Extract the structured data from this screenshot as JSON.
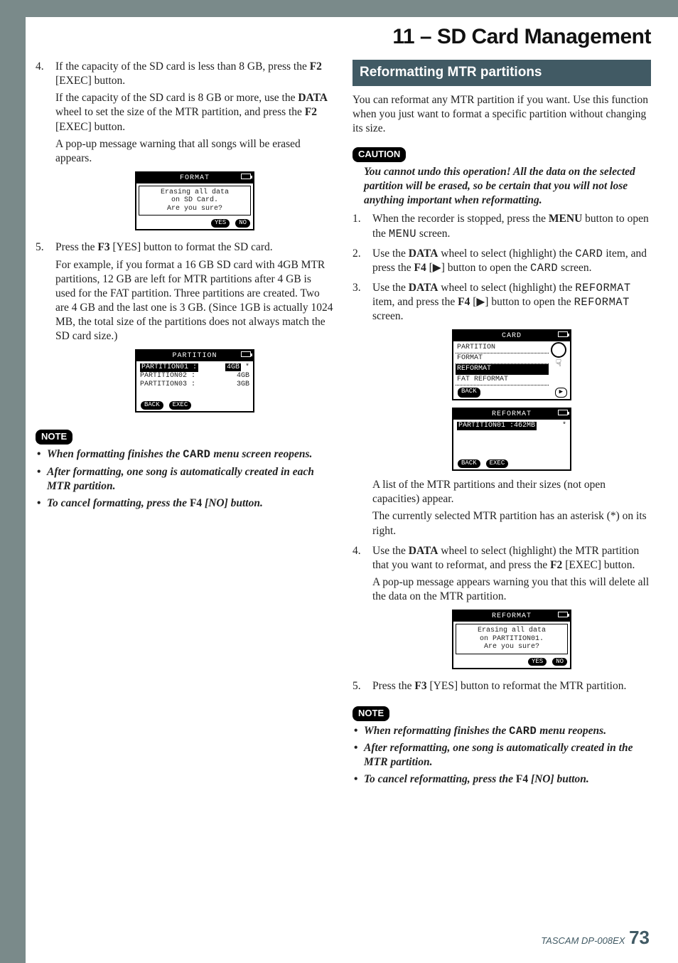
{
  "chapter_title": "11 – SD Card Management",
  "left": {
    "step4": {
      "num": "4.",
      "p1_a": "If the capacity of the SD card is less than 8 GB, press the ",
      "p1_b": "F2",
      "p1_c": " [EXEC] button.",
      "p2_a": "If the capacity of the SD card is 8 GB or more, use the ",
      "p2_b": "DATA",
      "p2_c": " wheel to set the size of the MTR partition, and press the ",
      "p2_d": "F2",
      "p2_e": " [EXEC] button.",
      "p3": "A pop-up message warning that all songs will be erased appears."
    },
    "lcd_format": {
      "title": "FORMAT",
      "line1": "Erasing all data",
      "line2": "on SD Card.",
      "line3": "Are you sure?",
      "yes": "YES",
      "no": "NO"
    },
    "step5": {
      "num": "5.",
      "p1_a": "Press the ",
      "p1_b": "F3",
      "p1_c": " [YES] button to format the SD card.",
      "p2": "For example, if you format a 16 GB SD card with 4GB MTR partitions, 12 GB are left for MTR partitions after 4 GB is used for the FAT partition. Three partitions are created. Two are 4 GB and the last one is 3 GB. (Since 1GB is actually 1024 MB, the total size of the partitions does not always match the SD card size.)"
    },
    "lcd_partition": {
      "title": "PARTITION",
      "r1a": "PARTITION01 :",
      "r1b": "4GB",
      "r1s": "*",
      "r2a": "PARTITION02 :",
      "r2b": "4GB",
      "r3a": "PARTITION03 :",
      "r3b": "3GB",
      "back": "BACK",
      "exec": "EXEC"
    },
    "note_label": "NOTE",
    "notes": {
      "n1_a": "When formatting finishes the ",
      "n1_b": "CARD",
      "n1_c": " menu screen reopens.",
      "n2": "After formatting, one song is automatically created in each MTR partition.",
      "n3_a": "To cancel formatting, press the ",
      "n3_b": "F4",
      "n3_c": " [NO] button."
    }
  },
  "right": {
    "heading": "Reformatting MTR partitions",
    "intro": "You can reformat any MTR partition if you want. Use this function when you just want to format a specific partition without changing its size.",
    "caution_label": "CAUTION",
    "caution": "You cannot undo this operation! All the data on the selected partition will be erased, so be certain that you will not lose anything important when reformatting.",
    "step1": {
      "num": "1.",
      "a": "When the recorder is stopped, press the ",
      "b": "MENU",
      "c": " button to open the ",
      "d": "MENU",
      "e": " screen."
    },
    "step2": {
      "num": "2.",
      "a": "Use the ",
      "b": "DATA",
      "c": " wheel to select (highlight) the ",
      "d": "CARD",
      "e": " item, and press the ",
      "f": "F4",
      "g": " [▶] button to open the ",
      "h": "CARD",
      "i": " screen."
    },
    "step3": {
      "num": "3.",
      "a": "Use the ",
      "b": "DATA",
      "c": " wheel to select (highlight) the ",
      "d": "REFORMAT",
      "e": " item, and press the ",
      "f": "F4",
      "g": " [▶] button to open the ",
      "h": "REFORMAT",
      "i": " screen."
    },
    "lcd_card": {
      "title": "CARD",
      "i1": "PARTITION",
      "i2": "FORMAT",
      "i3": "REFORMAT",
      "i4": "FAT REFORMAT",
      "back": "BACK",
      "play": "▶"
    },
    "lcd_reformat_list": {
      "title": "REFORMAT",
      "row": "PARTITION01 :462MB",
      "star": "*",
      "back": "BACK",
      "exec": "EXEC"
    },
    "after_lcd1": "A list of the MTR partitions and their sizes (not open capacities) appear.",
    "after_lcd2": "The currently selected MTR partition has an asterisk (*) on its right.",
    "step4": {
      "num": "4.",
      "a": "Use the ",
      "b": "DATA",
      "c": " wheel to select (highlight) the MTR partition that you want to reformat, and press the ",
      "d": "F2",
      "e": " [EXEC] button.",
      "p2": "A pop-up message appears warning you that this will delete all the data on the MTR partition."
    },
    "lcd_reformat_confirm": {
      "title": "REFORMAT",
      "l1": "Erasing all data",
      "l2": "on PARTITION01.",
      "l3": "Are you sure?",
      "yes": "YES",
      "no": "NO"
    },
    "step5": {
      "num": "5.",
      "a": "Press the ",
      "b": "F3",
      "c": " [YES] button to reformat the MTR partition."
    },
    "note_label": "NOTE",
    "notes": {
      "n1_a": "When reformatting finishes the ",
      "n1_b": "CARD",
      "n1_c": " menu reopens.",
      "n2": "After reformatting, one song is automatically created in the MTR partition.",
      "n3_a": "To cancel reformatting, press the ",
      "n3_b": "F4",
      "n3_c": " [NO] button."
    }
  },
  "footer": {
    "model": "TASCAM  DP-008EX",
    "page": "73"
  }
}
